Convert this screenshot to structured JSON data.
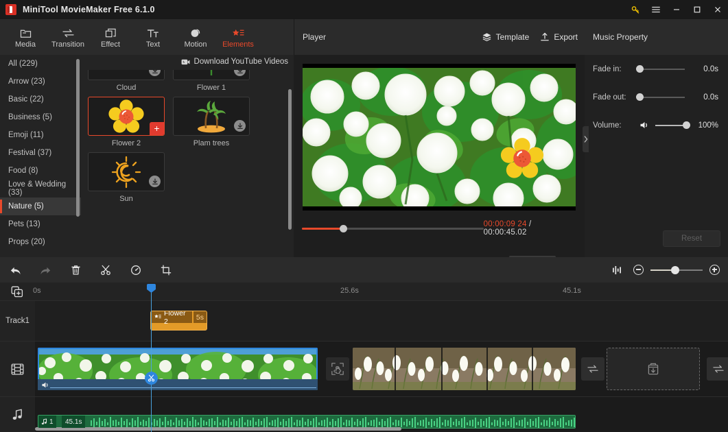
{
  "window": {
    "title": "MiniTool MovieMaker Free 6.1.0",
    "controls": {
      "key": "key-icon",
      "menu": "menu-icon",
      "minimize": "–",
      "maximize": "□",
      "close": "✕"
    }
  },
  "ribbon": {
    "items": [
      {
        "label": "Media",
        "icon": "folder-icon",
        "active": false
      },
      {
        "label": "Transition",
        "icon": "transition-icon",
        "active": false
      },
      {
        "label": "Effect",
        "icon": "effect-icon",
        "active": false
      },
      {
        "label": "Text",
        "icon": "text-icon",
        "active": false
      },
      {
        "label": "Motion",
        "icon": "motion-icon",
        "active": false
      },
      {
        "label": "Elements",
        "icon": "elements-icon",
        "active": true
      }
    ]
  },
  "categories": {
    "items": [
      {
        "label": "All (229)",
        "active": false
      },
      {
        "label": "Arrow (23)",
        "active": false
      },
      {
        "label": "Basic (22)",
        "active": false
      },
      {
        "label": "Business (5)",
        "active": false
      },
      {
        "label": "Emoji (11)",
        "active": false
      },
      {
        "label": "Festival (37)",
        "active": false
      },
      {
        "label": "Food (8)",
        "active": false
      },
      {
        "label": "Love & Wedding (33)",
        "active": false
      },
      {
        "label": "Nature (5)",
        "active": true
      },
      {
        "label": "Pets (13)",
        "active": false
      },
      {
        "label": "Props (20)",
        "active": false
      }
    ]
  },
  "library": {
    "download_youtube_label": "Download YouTube Videos",
    "elements": [
      {
        "label": "Cloud",
        "state": "download",
        "icon": "cloud-element"
      },
      {
        "label": "Flower 1",
        "state": "download",
        "icon": "flower1-element"
      },
      {
        "label": "Flower 2",
        "state": "selected",
        "icon": "flower2-element"
      },
      {
        "label": "Plam trees",
        "state": "download",
        "icon": "palm-element"
      },
      {
        "label": "Sun",
        "state": "download",
        "icon": "sun-element"
      }
    ]
  },
  "player": {
    "title": "Player",
    "template_label": "Template",
    "export_label": "Export",
    "current_time": "00:00:09 24",
    "total_time": "00:00:45.02",
    "progress_percent": 22.5,
    "aspect_ratio": "16:9",
    "volume_percent": 100,
    "controls": [
      "play",
      "previous-frame",
      "next-frame",
      "stop",
      "volume"
    ]
  },
  "music_property": {
    "title": "Music Property",
    "rows": [
      {
        "label": "Fade in:",
        "value": "0.0s",
        "knob_percent": 0
      },
      {
        "label": "Fade out:",
        "value": "0.0s",
        "knob_percent": 0
      }
    ],
    "volume": {
      "label": "Volume:",
      "value": "100%",
      "knob_percent": 100
    },
    "reset_label": "Reset"
  },
  "timeline_toolbar": {
    "buttons": [
      {
        "name": "undo-button",
        "icon": "undo-icon",
        "disabled": false
      },
      {
        "name": "redo-button",
        "icon": "redo-icon",
        "disabled": true
      },
      {
        "name": "delete-button",
        "icon": "trash-icon",
        "disabled": false
      },
      {
        "name": "split-button",
        "icon": "scissors-icon",
        "disabled": false
      },
      {
        "name": "speed-button",
        "icon": "speed-icon",
        "disabled": false
      },
      {
        "name": "crop-button",
        "icon": "crop-icon",
        "disabled": false
      }
    ],
    "zoom_percent": 48
  },
  "timeline": {
    "ruler_ticks": [
      "0s",
      "25.6s",
      "45.1s"
    ],
    "tracks": [
      {
        "name": "Track1",
        "label": "Track1",
        "type": "element"
      },
      {
        "name": "video-track",
        "label": "",
        "type": "video",
        "icon": "film-icon"
      },
      {
        "name": "audio-track",
        "label": "",
        "type": "audio",
        "icon": "music-note-icon"
      }
    ],
    "element_clip": {
      "name": "Flower 2",
      "duration": "5s"
    },
    "audio_clip": {
      "index": "1",
      "duration": "45.1s"
    },
    "add_media_icon": "add-media-icon"
  }
}
